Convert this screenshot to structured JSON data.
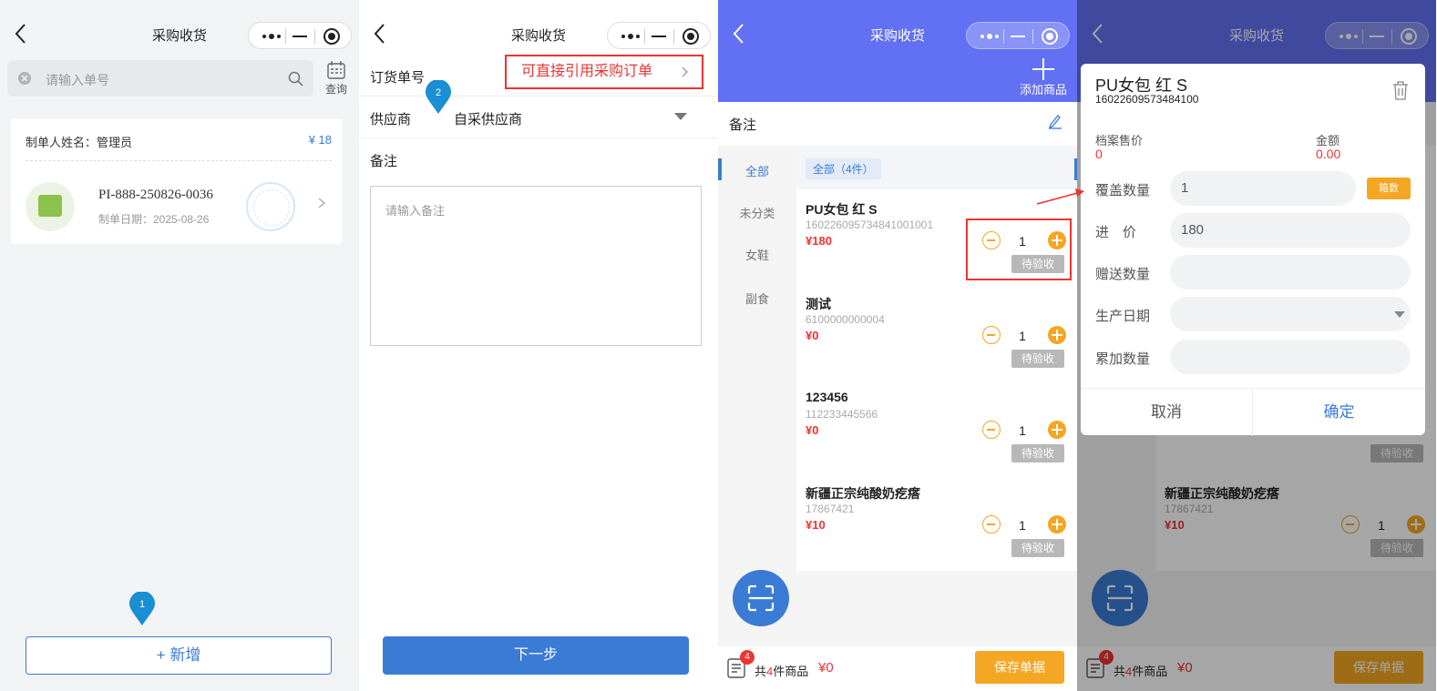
{
  "nav_title": "采购收货",
  "panel1": {
    "search_placeholder": "请输入单号",
    "query_label": "查询",
    "card": {
      "maker": "制单人姓名：管理员",
      "amount": "¥ 18",
      "doc_no": "PI-888-250826-0036",
      "date": "制单日期：2025-08-26"
    },
    "pin_label": "1",
    "add_label": "+ 新增"
  },
  "panel2": {
    "order_no_label": "订货单号",
    "hint": "可直接引用采购订单",
    "pin_label": "2",
    "supplier_label": "供应商",
    "supplier_value": "自采供应商",
    "remark_label": "备注",
    "remark_placeholder": "请输入备注",
    "next_label": "下一步"
  },
  "panel3": {
    "add_product_label": "添加商品",
    "remark_label": "备注",
    "categories": [
      {
        "label": "全部",
        "active": true
      },
      {
        "label": "未分类",
        "active": false
      },
      {
        "label": "女鞋",
        "active": false
      },
      {
        "label": "副食",
        "active": false
      }
    ],
    "filter_tag": "全部（4件）",
    "products": [
      {
        "name": "PU女包 红 S",
        "code": "16022609573484100​1001",
        "price": "¥180",
        "qty": "1",
        "status": "待验收"
      },
      {
        "name": "测试",
        "code": "6100000000004",
        "price": "¥0",
        "qty": "1",
        "status": "待验收"
      },
      {
        "name": "123456",
        "code": "112233445566",
        "price": "¥0",
        "qty": "1",
        "status": "待验收"
      },
      {
        "name": "新疆正宗纯酸奶疙瘩",
        "code": "17867421",
        "price": "¥10",
        "qty": "1",
        "status": "待验收"
      }
    ],
    "footer": {
      "badge": "4",
      "sum_prefix": "共",
      "sum_count": "4",
      "sum_suffix": "件商品",
      "money": "¥0",
      "save_label": "保存单据"
    }
  },
  "panel4": {
    "dialog": {
      "name": "PU女包 红 S",
      "code": "16022609573484100",
      "archive_price_label": "档案售价",
      "archive_price_value": "0",
      "amount_label": "金额",
      "amount_value": "0.00",
      "cover_qty_label": "覆盖数量",
      "cover_qty_value": "1",
      "box_label": "箱数",
      "price_label": "进　价",
      "price_value": "180",
      "gift_qty_label": "赠送数量",
      "gift_qty_value": "",
      "prod_date_label": "生产日期",
      "accum_qty_label": "累加数量",
      "accum_qty_value": "",
      "cancel_label": "取消",
      "ok_label": "确定"
    },
    "bg_product": {
      "name": "新疆正宗纯酸奶疙瘩",
      "code": "17867421",
      "price": "¥10",
      "qty": "1",
      "status": "待验收"
    },
    "bg_status_above": "待验收"
  },
  "colors": {
    "brand_blue": "#3a7bd5",
    "header_purple": "#6270f3",
    "accent_orange": "#f5a623",
    "alert_red": "#e33"
  }
}
